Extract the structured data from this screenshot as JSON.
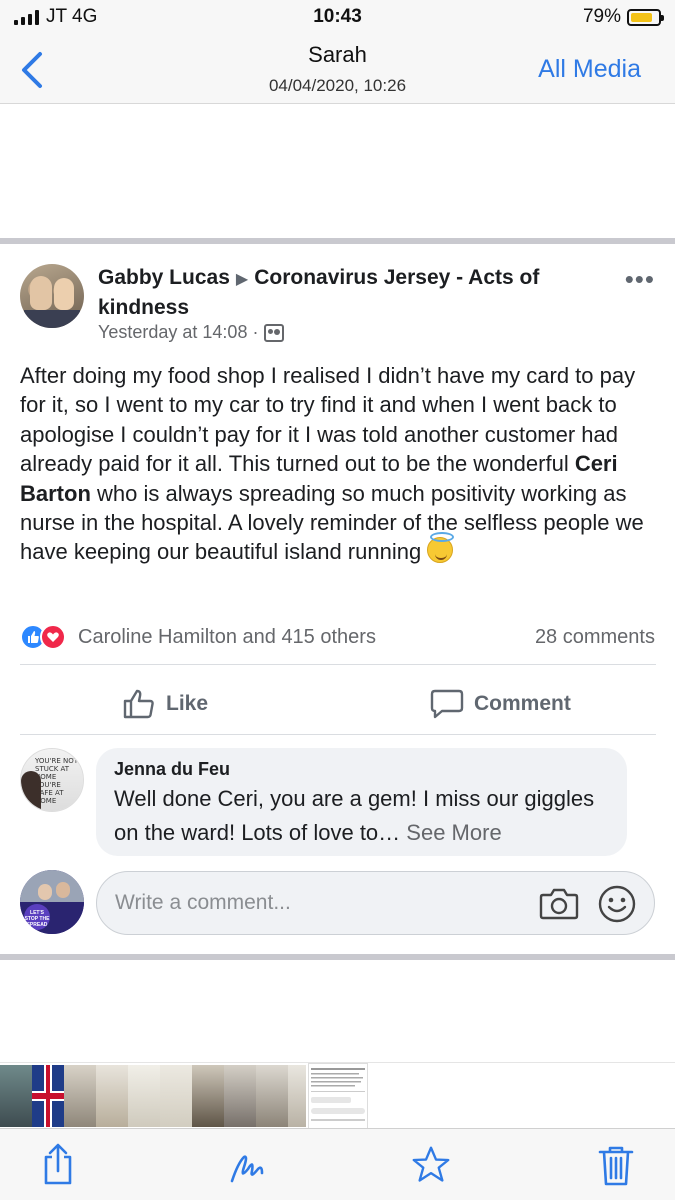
{
  "status": {
    "carrier": "JT  4G",
    "time": "10:43",
    "battery": "79%",
    "battery_level": 0.79
  },
  "nav": {
    "title": "Sarah",
    "subtitle": "04/04/2020, 10:26",
    "right_label": "All Media"
  },
  "post": {
    "author": "Gabby Lucas",
    "arrow": "▶",
    "group": "Coronavirus Jersey - Acts of kindness",
    "time": "Yesterday at 14:08 ·",
    "body_1": "After doing my food shop I realised I didn’t have my card to pay for it, so I went to my car to try find it and when I went back to apologise I couldn’t pay for it I was told another customer had already paid for it all. This turned out to be the wonderful ",
    "body_name": "Ceri Barton",
    "body_2": " who is always spreading so much positivity working as nurse in the hospital. A lovely reminder of the selfless people we have keeping our beautiful island running",
    "reactions_text": "Caroline Hamilton and 415 others",
    "comments_count": "28 comments",
    "like_label": "Like",
    "comment_label": "Comment"
  },
  "comment": {
    "name": "Jenna du Feu",
    "text": "Well done Ceri, you are a gem! I miss our giggles on the ward! Lots of love to…",
    "see_more": "See More"
  },
  "composer": {
    "placeholder": "Write a comment..."
  },
  "icons": {
    "back": "chevron-left-icon",
    "share": "share-icon",
    "markup": "markup-icon",
    "favorite": "star-icon",
    "delete": "trash-icon",
    "camera": "camera-icon",
    "emoji": "smiley-icon"
  },
  "colors": {
    "accent": "#2f7ae5",
    "like_blue": "#2d88ff",
    "love_red": "#f0284a",
    "battery": "#f3c218"
  }
}
